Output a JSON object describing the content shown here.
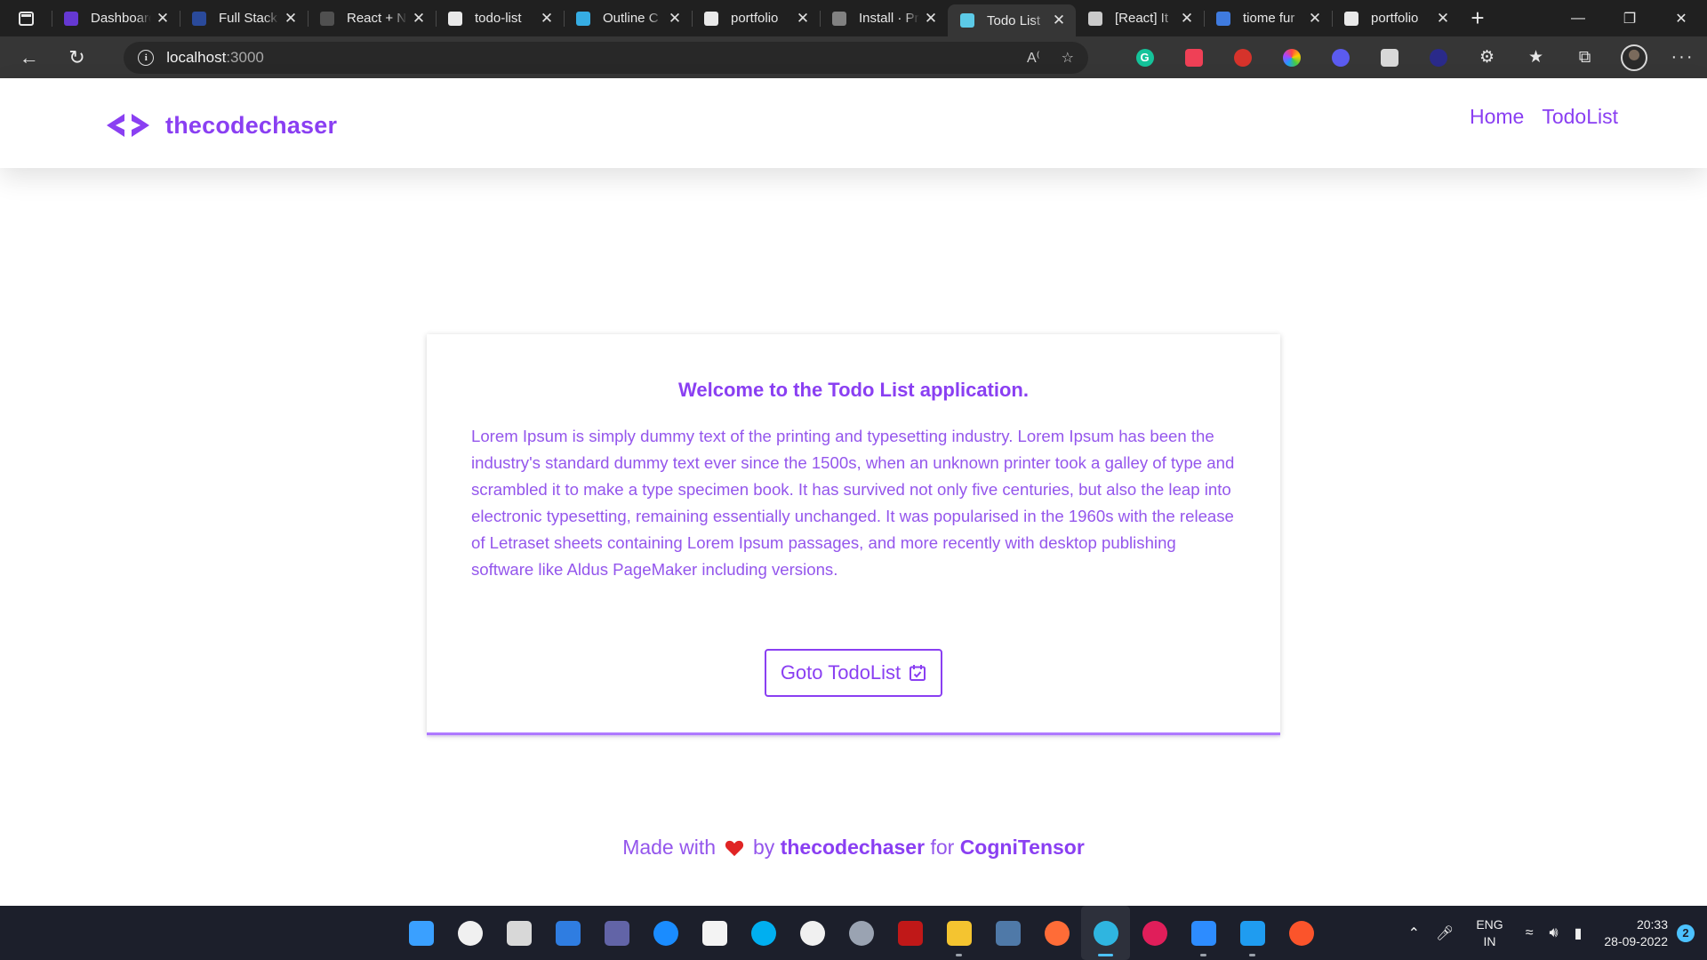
{
  "browser": {
    "tabs": [
      {
        "title": "Dashboard",
        "favicon": "make-logo-icon",
        "color": "#6d3be6",
        "active": false
      },
      {
        "title": "Full Stack",
        "favicon": "info-logo-icon",
        "color": "#2b4fa8",
        "active": false
      },
      {
        "title": "React + N",
        "favicon": "z-logo-icon",
        "color": "#555555",
        "active": false
      },
      {
        "title": "todo-list",
        "favicon": "github-icon",
        "color": "#ffffff",
        "active": false
      },
      {
        "title": "Outline C",
        "favicon": "tailwind-icon",
        "color": "#38bdf8",
        "active": false
      },
      {
        "title": "portfolio",
        "favicon": "github-icon",
        "color": "#ffffff",
        "active": false
      },
      {
        "title": "Install · Pr",
        "favicon": "prisma-icon",
        "color": "#8c8c8c",
        "active": false
      },
      {
        "title": "Todo List",
        "favicon": "react-icon",
        "color": "#61dafb",
        "active": true
      },
      {
        "title": "[React] It",
        "favicon": "angular-a-icon",
        "color": "#dddddd",
        "active": false
      },
      {
        "title": "tiome fur",
        "favicon": "google-icon",
        "color": "#4285f4",
        "active": false
      },
      {
        "title": "portfolio",
        "favicon": "github-icon",
        "color": "#ffffff",
        "active": false
      }
    ],
    "url_host": "localhost",
    "url_port": ":3000"
  },
  "site": {
    "brand": "thecodechaser",
    "nav": [
      "Home",
      "TodoList"
    ]
  },
  "card": {
    "title": "Welcome to the Todo List application.",
    "body": "Lorem Ipsum is simply dummy text of the printing and typesetting industry. Lorem Ipsum has been the industry's standard dummy text ever since the 1500s, when an unknown printer took a galley of type and scrambled it to make a type specimen book. It has survived not only five centuries, but also the leap into electronic typesetting, remaining essentially unchanged. It was popularised in the 1960s with the release of Letraset sheets containing Lorem Ipsum passages, and more recently with desktop publishing software like Aldus PageMaker including versions.",
    "button": "Goto TodoList"
  },
  "footer": {
    "made_with": "Made with",
    "by": "by",
    "author": "thecodechaser",
    "for": "for",
    "org": "CogniTensor"
  },
  "taskbar": {
    "apps": [
      {
        "name": "start-icon",
        "color": "#3aa0ff"
      },
      {
        "name": "search-icon",
        "color": "#f0f0f0"
      },
      {
        "name": "task-view-icon",
        "color": "#d8d8d8"
      },
      {
        "name": "widgets-icon",
        "color": "#2f7de1"
      },
      {
        "name": "teams-chat-icon",
        "color": "#6264a7"
      },
      {
        "name": "help-icon",
        "color": "#1a8cff"
      },
      {
        "name": "store-icon",
        "color": "#f3f3f3"
      },
      {
        "name": "skype-icon",
        "color": "#00aff0"
      },
      {
        "name": "github-desktop-icon",
        "color": "#f0f0f0"
      },
      {
        "name": "settings-icon",
        "color": "#9aa3b2"
      },
      {
        "name": "mcafee-icon",
        "color": "#c01818"
      },
      {
        "name": "file-explorer-icon",
        "color": "#f4c430"
      },
      {
        "name": "postgres-icon",
        "color": "#4f79a8"
      },
      {
        "name": "postman-icon",
        "color": "#ff6c37"
      },
      {
        "name": "edge-icon",
        "color": "#2fb5e0"
      },
      {
        "name": "slack-icon",
        "color": "#e01e5a"
      },
      {
        "name": "zoom-icon",
        "color": "#2d8cff"
      },
      {
        "name": "vscode-icon",
        "color": "#1f9cf0"
      },
      {
        "name": "brave-icon",
        "color": "#fb542b"
      }
    ],
    "lang_top": "ENG",
    "lang_bottom": "IN",
    "time": "20:33",
    "date": "28-09-2022",
    "notifications": "2"
  },
  "colors": {
    "brand_purple": "#8a3ff2",
    "heart_red": "#e02424"
  }
}
